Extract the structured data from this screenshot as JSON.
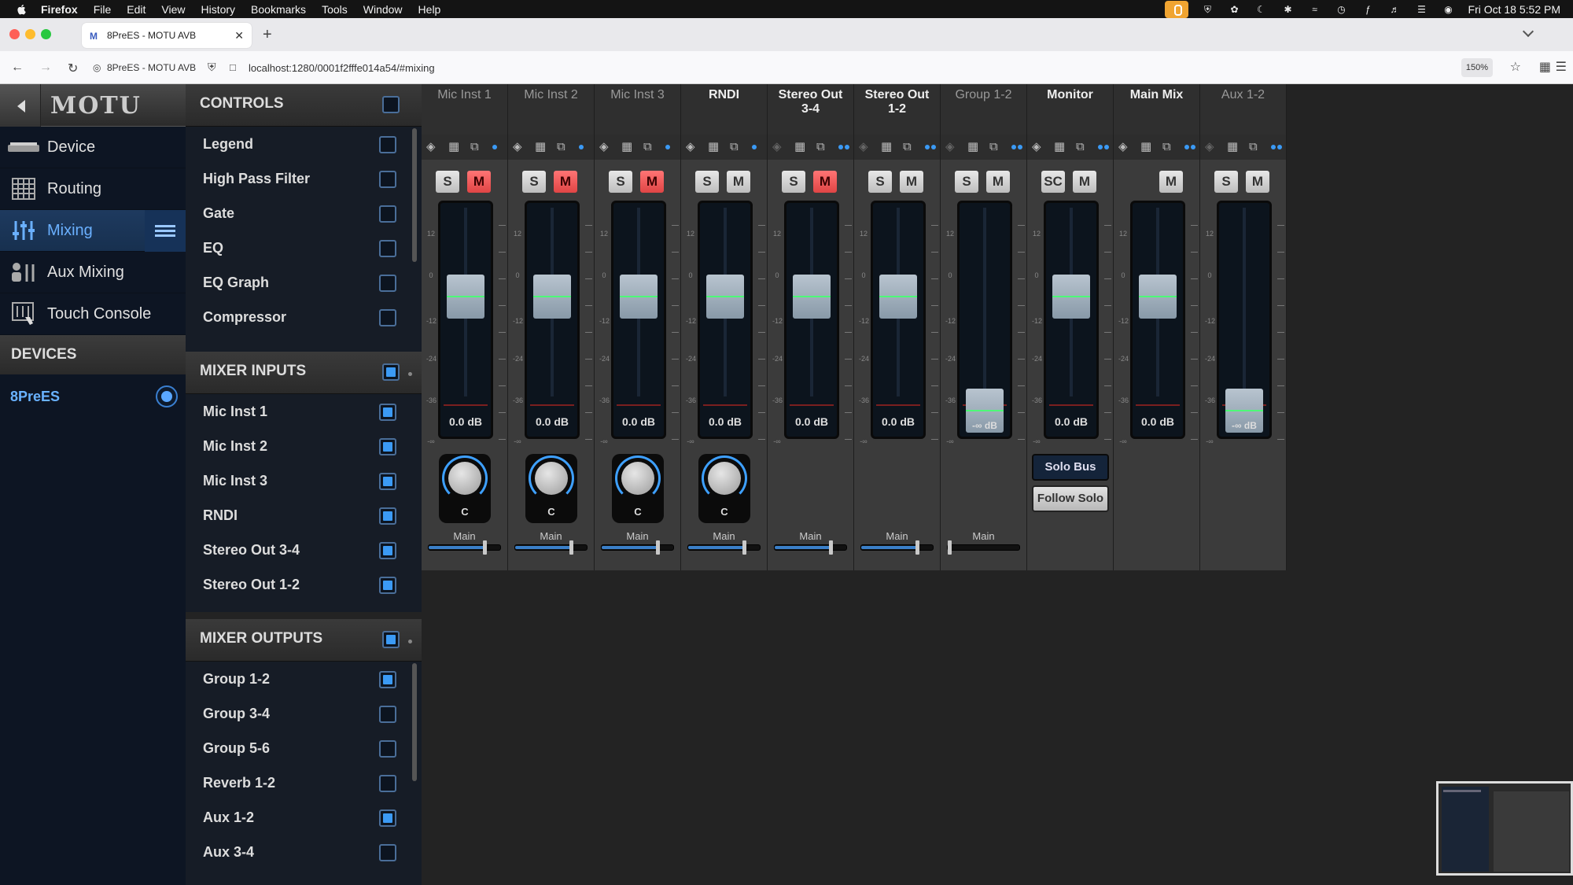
{
  "menubar": {
    "app": "Firefox",
    "items": [
      "File",
      "Edit",
      "View",
      "History",
      "Bookmarks",
      "Tools",
      "Window",
      "Help"
    ],
    "clock": "Fri Oct 18  5:52 PM"
  },
  "browser": {
    "tab_title": "8PreES - MOTU AVB",
    "tab_favicon": "M",
    "site_label": "8PreES - MOTU AVB",
    "url": "localhost:1280/0001f2fffe014a54/#mixing",
    "zoom": "150%"
  },
  "sidebar": {
    "brand": "MOTU",
    "nav": [
      {
        "label": "Device",
        "icon": "device-icon"
      },
      {
        "label": "Routing",
        "icon": "routing-grid-icon"
      },
      {
        "label": "Mixing",
        "icon": "mixer-sliders-icon",
        "active": true
      },
      {
        "label": "Aux Mixing",
        "icon": "aux-mixing-icon"
      },
      {
        "label": "Touch Console",
        "icon": "touch-console-icon"
      }
    ],
    "devices_header": "DEVICES",
    "device": "8PreES"
  },
  "controls": {
    "header": "CONTROLS",
    "items": [
      {
        "label": "Legend",
        "checked": false
      },
      {
        "label": "High Pass Filter",
        "checked": false
      },
      {
        "label": "Gate",
        "checked": false
      },
      {
        "label": "EQ",
        "checked": false
      },
      {
        "label": "EQ Graph",
        "checked": false
      },
      {
        "label": "Compressor",
        "checked": false
      }
    ]
  },
  "mixer_inputs": {
    "header": "MIXER INPUTS",
    "items": [
      {
        "label": "Mic Inst 1",
        "checked": true
      },
      {
        "label": "Mic Inst 2",
        "checked": true
      },
      {
        "label": "Mic Inst 3",
        "checked": true
      },
      {
        "label": "RNDI",
        "checked": true
      },
      {
        "label": "Stereo Out 3-4",
        "checked": true
      },
      {
        "label": "Stereo Out 1-2",
        "checked": true
      }
    ]
  },
  "mixer_outputs": {
    "header": "MIXER OUTPUTS",
    "items": [
      {
        "label": "Group 1-2",
        "checked": true
      },
      {
        "label": "Group 3-4",
        "checked": false
      },
      {
        "label": "Group 5-6",
        "checked": false
      },
      {
        "label": "Reverb 1-2",
        "checked": false
      },
      {
        "label": "Aux 1-2",
        "checked": true
      },
      {
        "label": "Aux 3-4",
        "checked": false
      }
    ]
  },
  "scale_labels": [
    "12",
    "0",
    "-12",
    "-24",
    "-36",
    "-∞"
  ],
  "strips": [
    {
      "name": "Mic Inst 1",
      "name_style": "grey",
      "solo": "S",
      "mute": "M",
      "muted": true,
      "level": "0.0 dB",
      "fader_pos": 0.25,
      "pan": "C",
      "send": "Main",
      "send_value": 0.78
    },
    {
      "name": "Mic Inst 2",
      "name_style": "grey",
      "solo": "S",
      "mute": "M",
      "muted": true,
      "level": "0.0 dB",
      "fader_pos": 0.25,
      "pan": "C",
      "send": "Main",
      "send_value": 0.78
    },
    {
      "name": "Mic Inst 3",
      "name_style": "grey",
      "solo": "S",
      "mute": "M",
      "muted": true,
      "level": "0.0 dB",
      "fader_pos": 0.25,
      "pan": "C",
      "send": "Main",
      "send_value": 0.78
    },
    {
      "name": "RNDI",
      "name_style": "white",
      "solo": "S",
      "mute": "M",
      "muted": false,
      "level": "0.0 dB",
      "fader_pos": 0.25,
      "pan": "C",
      "send": "Main",
      "send_value": 0.78
    },
    {
      "name": "Stereo Out 3-4",
      "name_style": "white",
      "solo": "S",
      "mute": "M",
      "muted": true,
      "level": "0.0 dB",
      "fader_pos": 0.25,
      "send": "Main",
      "send_value": 0.78
    },
    {
      "name": "Stereo Out 1-2",
      "name_style": "white",
      "solo": "S",
      "mute": "M",
      "muted": false,
      "level": "0.0 dB",
      "fader_pos": 0.25,
      "send": "Main",
      "send_value": 0.78
    },
    {
      "name": "Group 1-2",
      "name_style": "grey",
      "solo": "S",
      "mute": "M",
      "muted": false,
      "level": "-∞ dB",
      "fader_pos": 1.0,
      "send": "Main",
      "send_value": 0.0
    },
    {
      "name": "Monitor",
      "name_style": "white",
      "solo": "SC",
      "mute": "M",
      "muted": false,
      "level": "0.0 dB",
      "fader_pos": 0.25,
      "solo_bus": "Solo Bus",
      "follow_solo": "Follow Solo"
    },
    {
      "name": "Main Mix",
      "name_style": "white",
      "mute": "M",
      "muted": false,
      "level": "0.0 dB",
      "fader_pos": 0.25
    },
    {
      "name": "Aux 1-2",
      "name_style": "grey",
      "solo": "S",
      "mute": "M",
      "muted": false,
      "level": "-∞ dB",
      "fader_pos": 1.0
    }
  ]
}
